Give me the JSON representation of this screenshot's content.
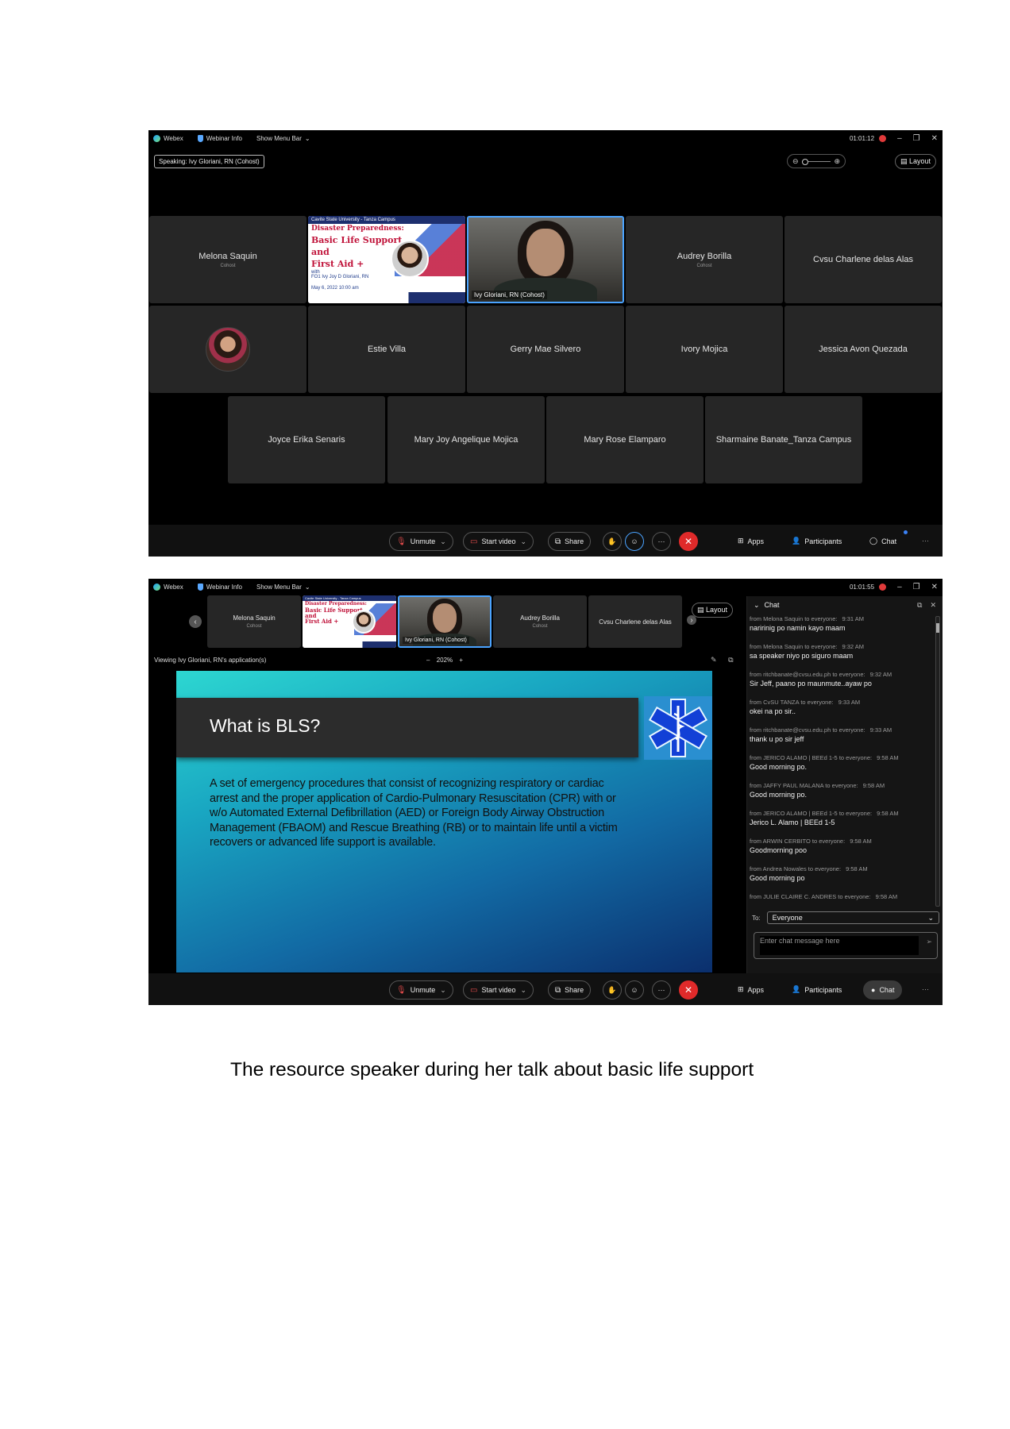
{
  "common": {
    "app_name": "Webex",
    "webinar_info": "Webinar Info",
    "show_menu_bar": "Show Menu Bar",
    "layout": "Layout",
    "toolbar": {
      "unmute": "Unmute",
      "start_video": "Start video",
      "share": "Share",
      "more": "···",
      "end": "✕",
      "apps": "Apps",
      "participants": "Participants",
      "chat": "Chat"
    }
  },
  "shot1": {
    "timer": "01:01:12",
    "speaking": "Speaking: Ivy Gloriani, RN (Cohost)",
    "tiles": [
      {
        "name": "Melona Saquin",
        "sub": "Cohost"
      },
      {
        "name": "Audrey Borilla",
        "sub": "Cohost"
      },
      {
        "name": "Cvsu Charlene delas Alas"
      },
      {
        "name": "Estie Villa"
      },
      {
        "name": "Gerry Mae Silvero"
      },
      {
        "name": "Ivory Mojica"
      },
      {
        "name": "Jessica Avon Quezada"
      },
      {
        "name": "Joyce Erika Senaris"
      },
      {
        "name": "Mary Joy Angelique Mojica"
      },
      {
        "name": "Mary Rose Elamparo"
      },
      {
        "name": "Sharmaine Banate_Tanza Campus"
      }
    ],
    "active_speaker": "Ivy Gloriani, RN (Cohost)",
    "slide_thumb": {
      "header": "Cavite State University - Tanza Campus",
      "title_line1": "Disaster Preparedness:",
      "title_line2": "Basic Life Support",
      "title_line3": "and",
      "title_line4": "First Aid +",
      "with": "with",
      "speaker": "FO1 Ivy Joy D Gloriani, RN",
      "date": "May 6, 2022 10:00 am"
    }
  },
  "shot2": {
    "timer": "01:01:55",
    "thumb_tiles": [
      {
        "name": "Melona Saquin",
        "sub": "Cohost"
      },
      {
        "name": "Audrey Borilla",
        "sub": "Cohost"
      },
      {
        "name": "Cvsu Charlene delas Alas"
      }
    ],
    "active_speaker": "Ivy Gloriani, RN (Cohost)",
    "viewing": "Viewing Ivy Gloriani, RN's application(s)",
    "zoom": "202%",
    "slide": {
      "title": "What is BLS?",
      "body": "A set of emergency procedures that consist of recognizing respiratory or cardiac arrest and the proper application of Cardio-Pulmonary Resuscitation (CPR) with or w/o Automated External Defibrillation (AED) or Foreign Body Airway Obstruction Management (FBAOM) and Rescue Breathing (RB) or to maintain life until a victim recovers or advanced life support is available."
    },
    "chat": {
      "title": "Chat",
      "messages": [
        {
          "from": "from Melona Saquin to everyone:",
          "time": "9:31 AM",
          "text": "naririnig po namin kayo maam"
        },
        {
          "from": "from Melona Saquin to everyone:",
          "time": "9:32 AM",
          "text": "sa speaker niyo po siguro maam"
        },
        {
          "from": "from ritchbanate@cvsu.edu.ph to everyone:",
          "time": "9:32 AM",
          "text": "Sir Jeff, paano po maunmute..ayaw po"
        },
        {
          "from": "from CvSU TANZA to everyone:",
          "time": "9:33 AM",
          "text": "okei na po sir.."
        },
        {
          "from": "from ritchbanate@cvsu.edu.ph to everyone:",
          "time": "9:33 AM",
          "text": "thank u po sir jeff"
        },
        {
          "from": "from JERICO ALAMO | BEEd 1-5 to everyone:",
          "time": "9:58 AM",
          "text": "Good morning po."
        },
        {
          "from": "from JAFFY PAUL MALANA to everyone:",
          "time": "9:58 AM",
          "text": "Good morning po."
        },
        {
          "from": "from JERICO ALAMO | BEEd 1-5 to everyone:",
          "time": "9:58 AM",
          "text": "Jerico L. Alamo | BEEd 1-5"
        },
        {
          "from": "from ARWIN CERBITO to everyone:",
          "time": "9:58 AM",
          "text": "Goodmorning poo"
        },
        {
          "from": "from Andrea Nowales to everyone:",
          "time": "9:58 AM",
          "text": "Good morning po"
        },
        {
          "from": "from JULIE CLAIRE C. ANDRES to everyone:",
          "time": "9:58 AM",
          "text": ""
        }
      ],
      "to_label": "To:",
      "to_value": "Everyone",
      "input_placeholder": "Enter chat message here"
    }
  },
  "caption": "The resource speaker during her talk about basic life support"
}
